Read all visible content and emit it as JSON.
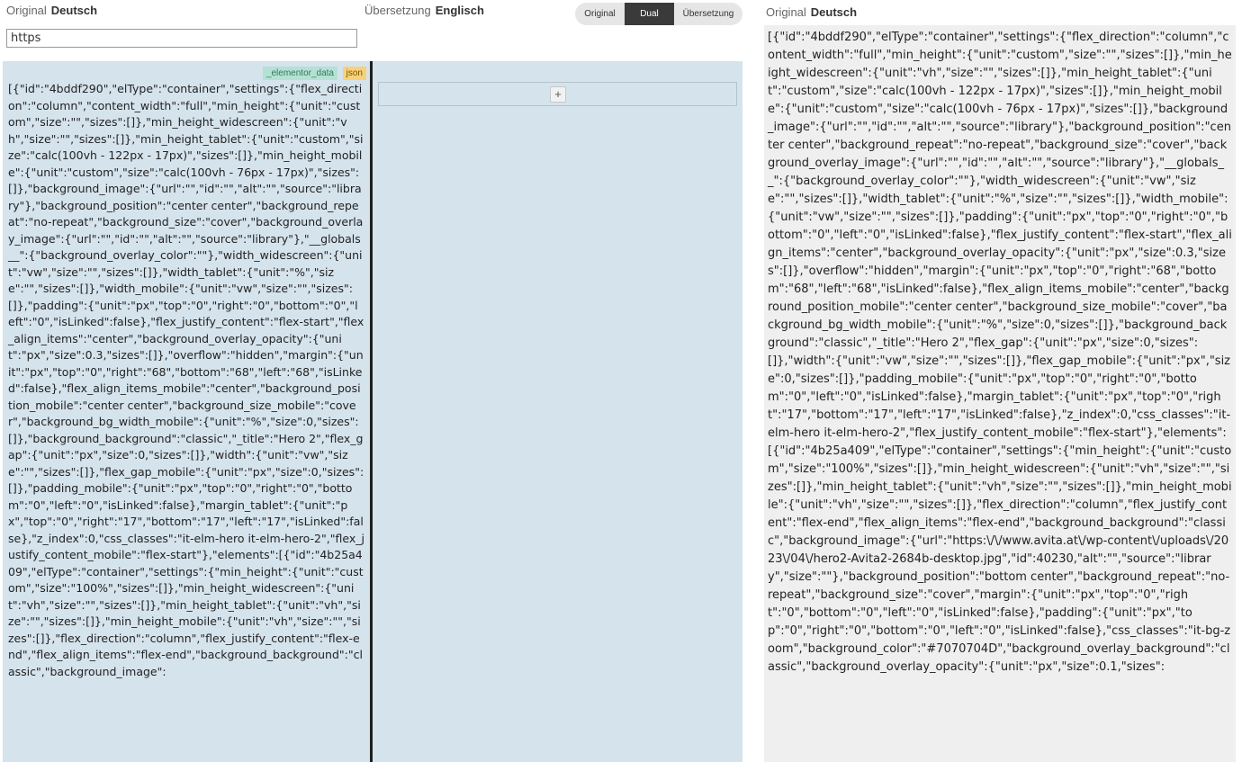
{
  "header": {
    "original_label": "Original",
    "original_lang": "Deutsch",
    "translation_label": "Übersetzung",
    "translation_lang": "Englisch",
    "right_label": "Original",
    "right_lang": "Deutsch"
  },
  "search": {
    "value": "https"
  },
  "view_toggle": {
    "options": [
      "Original",
      "Dual",
      "Übersetzung"
    ],
    "selected": "Dual"
  },
  "left_panel": {
    "badge_field": "_elementor_data",
    "badge_type": "json",
    "add_label": "+",
    "content": "[{\"id\":\"4bddf290\",\"elType\":\"container\",\"settings\":{\"flex_direction\":\"column\",\"content_width\":\"full\",\"min_height\":{\"unit\":\"custom\",\"size\":\"\",\"sizes\":[]},\"min_height_widescreen\":{\"unit\":\"vh\",\"size\":\"\",\"sizes\":[]},\"min_height_tablet\":{\"unit\":\"custom\",\"size\":\"calc(100vh - 122px - 17px)\",\"sizes\":[]},\"min_height_mobile\":{\"unit\":\"custom\",\"size\":\"calc(100vh - 76px - 17px)\",\"sizes\":[]},\"background_image\":{\"url\":\"\",\"id\":\"\",\"alt\":\"\",\"source\":\"library\"},\"background_position\":\"center center\",\"background_repeat\":\"no-repeat\",\"background_size\":\"cover\",\"background_overlay_image\":{\"url\":\"\",\"id\":\"\",\"alt\":\"\",\"source\":\"library\"},\"__globals__\":{\"background_overlay_color\":\"\"},\"width_widescreen\":{\"unit\":\"vw\",\"size\":\"\",\"sizes\":[]},\"width_tablet\":{\"unit\":\"%\",\"size\":\"\",\"sizes\":[]},\"width_mobile\":{\"unit\":\"vw\",\"size\":\"\",\"sizes\":[]},\"padding\":{\"unit\":\"px\",\"top\":\"0\",\"right\":\"0\",\"bottom\":\"0\",\"left\":\"0\",\"isLinked\":false},\"flex_justify_content\":\"flex-start\",\"flex_align_items\":\"center\",\"background_overlay_opacity\":{\"unit\":\"px\",\"size\":0.3,\"sizes\":[]},\"overflow\":\"hidden\",\"margin\":{\"unit\":\"px\",\"top\":\"0\",\"right\":\"68\",\"bottom\":\"68\",\"left\":\"68\",\"isLinked\":false},\"flex_align_items_mobile\":\"center\",\"background_position_mobile\":\"center center\",\"background_size_mobile\":\"cover\",\"background_bg_width_mobile\":{\"unit\":\"%\",\"size\":0,\"sizes\":[]},\"background_background\":\"classic\",\"_title\":\"Hero 2\",\"flex_gap\":{\"unit\":\"px\",\"size\":0,\"sizes\":[]},\"width\":{\"unit\":\"vw\",\"size\":\"\",\"sizes\":[]},\"flex_gap_mobile\":{\"unit\":\"px\",\"size\":0,\"sizes\":[]},\"padding_mobile\":{\"unit\":\"px\",\"top\":\"0\",\"right\":\"0\",\"bottom\":\"0\",\"left\":\"0\",\"isLinked\":false},\"margin_tablet\":{\"unit\":\"px\",\"top\":\"0\",\"right\":\"17\",\"bottom\":\"17\",\"left\":\"17\",\"isLinked\":false},\"z_index\":0,\"css_classes\":\"it-elm-hero it-elm-hero-2\",\"flex_justify_content_mobile\":\"flex-start\"},\"elements\":[{\"id\":\"4b25a409\",\"elType\":\"container\",\"settings\":{\"min_height\":{\"unit\":\"custom\",\"size\":\"100%\",\"sizes\":[]},\"min_height_widescreen\":{\"unit\":\"vh\",\"size\":\"\",\"sizes\":[]},\"min_height_tablet\":{\"unit\":\"vh\",\"size\":\"\",\"sizes\":[]},\"min_height_mobile\":{\"unit\":\"vh\",\"size\":\"\",\"sizes\":[]},\"flex_direction\":\"column\",\"flex_justify_content\":\"flex-end\",\"flex_align_items\":\"flex-end\",\"background_background\":\"classic\",\"background_image\":"
  },
  "right_panel": {
    "content": "[{\"id\":\"4bddf290\",\"elType\":\"container\",\"settings\":{\"flex_direction\":\"column\",\"content_width\":\"full\",\"min_height\":{\"unit\":\"custom\",\"size\":\"\",\"sizes\":[]},\"min_height_widescreen\":{\"unit\":\"vh\",\"size\":\"\",\"sizes\":[]},\"min_height_tablet\":{\"unit\":\"custom\",\"size\":\"calc(100vh - 122px - 17px)\",\"sizes\":[]},\"min_height_mobile\":{\"unit\":\"custom\",\"size\":\"calc(100vh - 76px - 17px)\",\"sizes\":[]},\"background_image\":{\"url\":\"\",\"id\":\"\",\"alt\":\"\",\"source\":\"library\"},\"background_position\":\"center center\",\"background_repeat\":\"no-repeat\",\"background_size\":\"cover\",\"background_overlay_image\":{\"url\":\"\",\"id\":\"\",\"alt\":\"\",\"source\":\"library\"},\"__globals__\":{\"background_overlay_color\":\"\"},\"width_widescreen\":{\"unit\":\"vw\",\"size\":\"\",\"sizes\":[]},\"width_tablet\":{\"unit\":\"%\",\"size\":\"\",\"sizes\":[]},\"width_mobile\":{\"unit\":\"vw\",\"size\":\"\",\"sizes\":[]},\"padding\":{\"unit\":\"px\",\"top\":\"0\",\"right\":\"0\",\"bottom\":\"0\",\"left\":\"0\",\"isLinked\":false},\"flex_justify_content\":\"flex-start\",\"flex_align_items\":\"center\",\"background_overlay_opacity\":{\"unit\":\"px\",\"size\":0.3,\"sizes\":[]},\"overflow\":\"hidden\",\"margin\":{\"unit\":\"px\",\"top\":\"0\",\"right\":\"68\",\"bottom\":\"68\",\"left\":\"68\",\"isLinked\":false},\"flex_align_items_mobile\":\"center\",\"background_position_mobile\":\"center center\",\"background_size_mobile\":\"cover\",\"background_bg_width_mobile\":{\"unit\":\"%\",\"size\":0,\"sizes\":[]},\"background_background\":\"classic\",\"_title\":\"Hero 2\",\"flex_gap\":{\"unit\":\"px\",\"size\":0,\"sizes\":[]},\"width\":{\"unit\":\"vw\",\"size\":\"\",\"sizes\":[]},\"flex_gap_mobile\":{\"unit\":\"px\",\"size\":0,\"sizes\":[]},\"padding_mobile\":{\"unit\":\"px\",\"top\":\"0\",\"right\":\"0\",\"bottom\":\"0\",\"left\":\"0\",\"isLinked\":false},\"margin_tablet\":{\"unit\":\"px\",\"top\":\"0\",\"right\":\"17\",\"bottom\":\"17\",\"left\":\"17\",\"isLinked\":false},\"z_index\":0,\"css_classes\":\"it-elm-hero it-elm-hero-2\",\"flex_justify_content_mobile\":\"flex-start\"},\"elements\":[{\"id\":\"4b25a409\",\"elType\":\"container\",\"settings\":{\"min_height\":{\"unit\":\"custom\",\"size\":\"100%\",\"sizes\":[]},\"min_height_widescreen\":{\"unit\":\"vh\",\"size\":\"\",\"sizes\":[]},\"min_height_tablet\":{\"unit\":\"vh\",\"size\":\"\",\"sizes\":[]},\"min_height_mobile\":{\"unit\":\"vh\",\"size\":\"\",\"sizes\":[]},\"flex_direction\":\"column\",\"flex_justify_content\":\"flex-end\",\"flex_align_items\":\"flex-end\",\"background_background\":\"classic\",\"background_image\":{\"url\":\"https:\\/\\/www.avita.at\\/wp-content\\/uploads\\/2023\\/04\\/hero2-Avita2-2684b-desktop.jpg\",\"id\":40230,\"alt\":\"\",\"source\":\"library\",\"size\":\"\"},\"background_position\":\"bottom center\",\"background_repeat\":\"no-repeat\",\"background_size\":\"cover\",\"margin\":{\"unit\":\"px\",\"top\":\"0\",\"right\":\"0\",\"bottom\":\"0\",\"left\":\"0\",\"isLinked\":false},\"padding\":{\"unit\":\"px\",\"top\":\"0\",\"right\":\"0\",\"bottom\":\"0\",\"left\":\"0\",\"isLinked\":false},\"css_classes\":\"it-bg-zoom\",\"background_color\":\"#7070704D\",\"background_overlay_background\":\"classic\",\"background_overlay_opacity\":{\"unit\":\"px\",\"size\":0.1,\"sizes\":"
  },
  "colors": {
    "left_panel_bg": "#d5e3ed",
    "right_panel_bg": "#efefef",
    "divider": "#1f1f1f",
    "toggle_active": "#3a3a3a"
  }
}
